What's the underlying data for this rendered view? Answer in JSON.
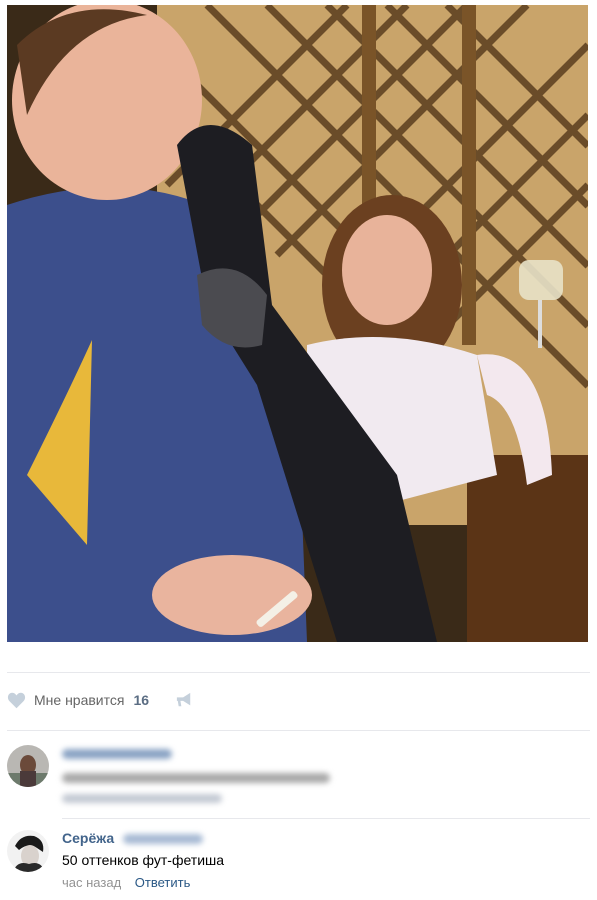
{
  "post": {
    "photo_alt": "",
    "likes": {
      "label": "Мне нравится",
      "count": "16"
    },
    "icons": {
      "like": "heart-icon",
      "share": "megaphone-icon"
    }
  },
  "comments": [
    {
      "author": "",
      "author_blurred": true,
      "text": "",
      "text_blurred": true,
      "time": "",
      "reply_label": "",
      "meta_blurred": true
    },
    {
      "author": "Серёжа",
      "author_surname_blurred": true,
      "text": "50 оттенков фут-фетиша",
      "time": "час назад",
      "reply_label": "Ответить"
    }
  ],
  "colors": {
    "link": "#2a5885",
    "author": "#42648b",
    "meta": "#939393",
    "divider": "#e7e8ec"
  }
}
